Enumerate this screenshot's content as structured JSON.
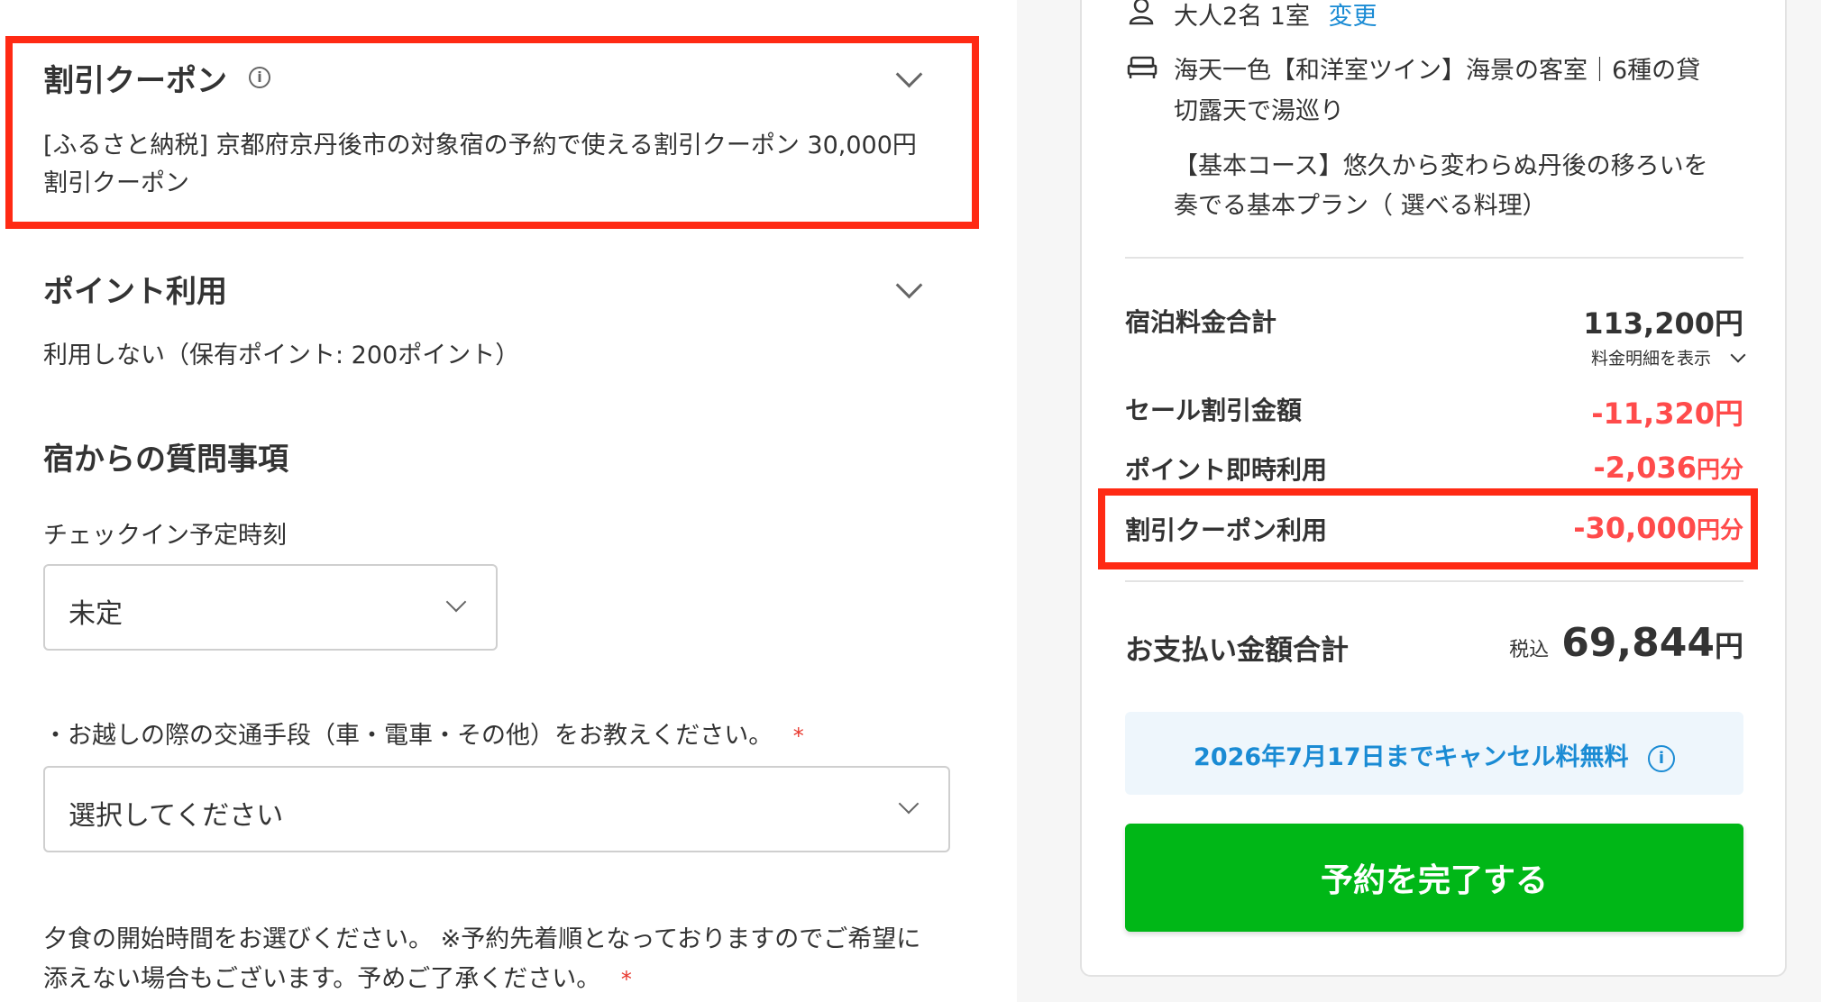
{
  "coupon": {
    "title": "割引クーポン",
    "info_icon": "i",
    "desc_line1": "[ふるさと納税] 京都府京丹後市の対象宿の予約で使える割引クーポン 30,000円",
    "desc_line2": "割引クーポン"
  },
  "points": {
    "title": "ポイント利用",
    "desc": "利用しない（保有ポイント: 200ポイント）"
  },
  "questions": {
    "title": "宿からの質問事項",
    "checkin_label": "チェックイン予定時刻",
    "checkin_value": "未定",
    "transport_label": "・お越しの際の交通手段（車・電車・その他）をお教えください。",
    "required_mark": "*",
    "transport_value": "選択してください",
    "dinner_line1": "夕食の開始時間をお選びください。 ※予約先着順となっておりますのでご希望に",
    "dinner_line2": "添えない場合もございます。予めご了承ください。"
  },
  "summary": {
    "guests": "大人2名 1室",
    "change_link": "変更",
    "room_line1": "海天一色【和洋室ツイン】海景の客室｜6種の貸",
    "room_line2": "切露天で湯巡り",
    "plan_line1": "【基本コース】悠久から変わらぬ丹後の移ろいを",
    "plan_line2": "奏でる基本プラン（ 選べる料理）",
    "stay_total_label": "宿泊料金合計",
    "stay_total_value": "113,200円",
    "breakdown_link": "料金明細を表示",
    "sale_label": "セール割引金額",
    "sale_value": "-11,320円",
    "point_label": "ポイント即時利用",
    "point_value": "-2,036",
    "point_unit": "円分",
    "coupon_label": "割引クーポン利用",
    "coupon_value": "-30,000",
    "coupon_unit": "円分",
    "total_label": "お支払い金額合計",
    "tax_label": "税込",
    "total_value": "69,844",
    "total_unit": "円",
    "cancel_text": "2026年7月17日までキャンセル料無料",
    "cancel_info_icon": "i",
    "cta_label": "予約を完了する"
  },
  "colors": {
    "highlight": "#ff2a14",
    "accent_green": "#00b717",
    "discount_red": "#ff4b4b",
    "link_blue": "#1a8bd4"
  },
  "icons": [
    "person-icon",
    "bed-icon",
    "info-icon",
    "chevron-down-icon"
  ]
}
